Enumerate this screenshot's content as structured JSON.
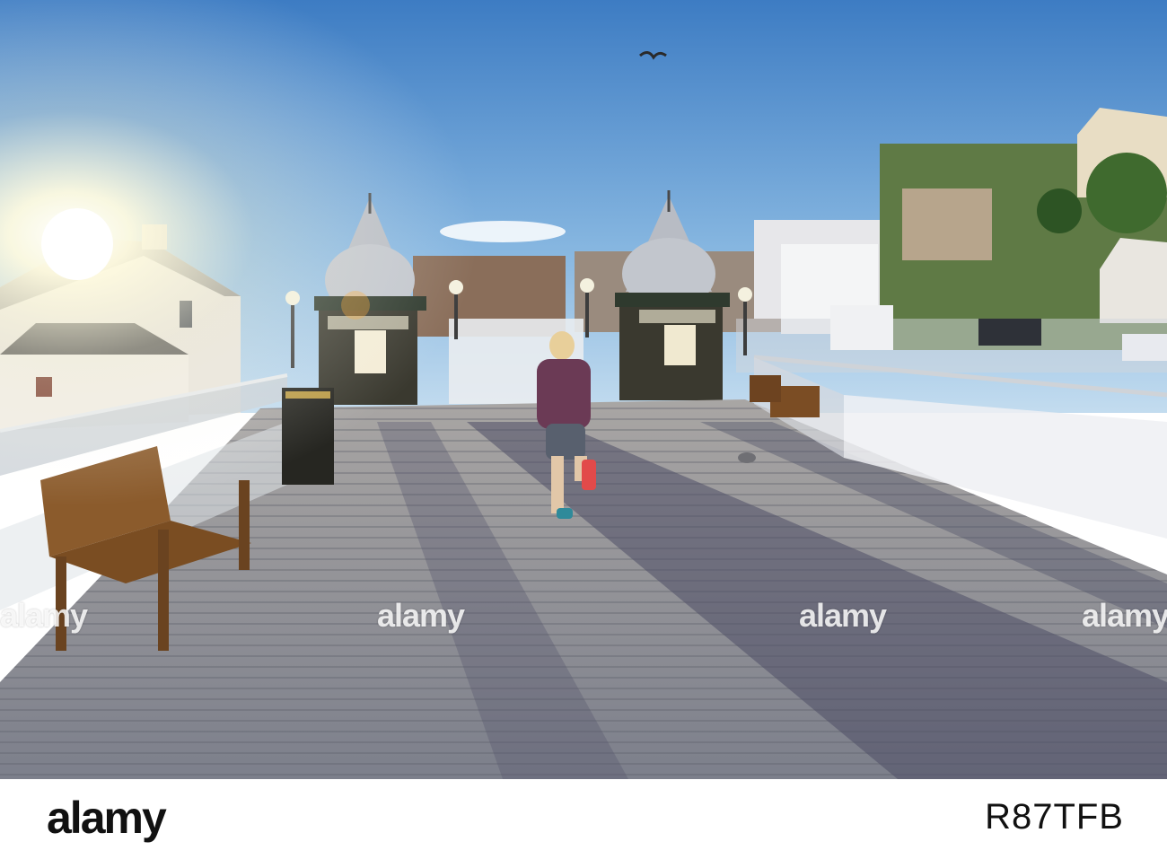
{
  "watermark": {
    "text": "alamy"
  },
  "footer": {
    "logo": "alamy",
    "image_id": "R87TFB"
  },
  "scene": {
    "sky_top": "#3f7fc6",
    "sky_bottom": "#a9cde8",
    "sun": "#fffbe6",
    "deck": "#8d8f97",
    "deck_shadow": "#4c4e63",
    "kiosk_roof": "#b9bdc4",
    "kiosk_body": "#3b3a33",
    "bench": "#8a5a2b",
    "runner_top": "#6b3a55",
    "runner_shorts": "#556070",
    "shoes": "#e24a4a"
  }
}
